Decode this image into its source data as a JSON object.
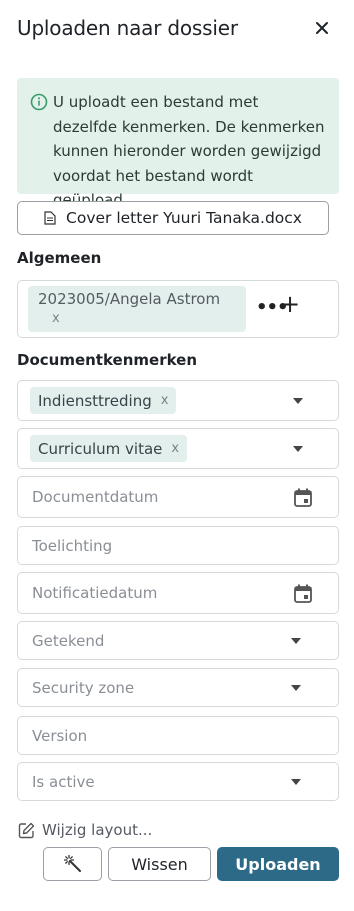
{
  "header": {
    "title": "Uploaden naar dossier"
  },
  "info": {
    "text": "U uploadt een bestand met dezelfde kenmerken. De kenmerken kunnen hieronder worden gewijzigd voordat het bestand wordt geüpload."
  },
  "file": {
    "name": "Cover letter Yuuri Tanaka.docx"
  },
  "algemeen": {
    "label": "Algemeen",
    "dossier": {
      "line1": "2023005/Angela Astrom",
      "remove": "x"
    },
    "more": "•••",
    "add": "+"
  },
  "kenmerken": {
    "label": "Documentkenmerken",
    "type": {
      "value": "Indiensttreding",
      "remove": "x"
    },
    "category": {
      "value": "Curriculum vitae",
      "remove": "x"
    },
    "placeholders": {
      "documentdatum": "Documentdatum",
      "toelichting": "Toelichting",
      "notificatiedatum": "Notificatiedatum",
      "getekend": "Getekend",
      "security_zone": "Security zone",
      "version": "Version",
      "is_active": "Is active"
    }
  },
  "footer": {
    "edit_layout": "Wijzig layout...",
    "clear_label": "Wissen",
    "upload_label": "Uploaden"
  },
  "colors": {
    "accent": "#2d6a87",
    "info_bg": "#e2f1ea",
    "chip_bg": "#e3efed",
    "info_icon": "#3a9a6a"
  }
}
